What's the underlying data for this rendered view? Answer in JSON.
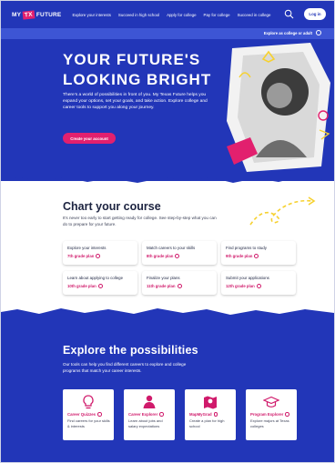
{
  "nav": {
    "logo_pre": "MY",
    "logo_tx": "TX",
    "logo_post": "FUTURE",
    "links": [
      "Explore your interests",
      "Succeed in high school",
      "Apply for college",
      "Pay for college",
      "Succeed in college"
    ],
    "search_icon": "search-icon",
    "login": "Log in"
  },
  "subbar": {
    "label": "Explore as college or adult"
  },
  "hero": {
    "title_line1": "YOUR FUTURE'S",
    "title_line2": "LOOKING BRIGHT",
    "body": "There's a world of possibilities in front of you. My Texas Future helps you expand your options, set your goals, and take action. Explore college and career tools to support you along your journey.",
    "cta": "Create your account"
  },
  "chart": {
    "title": "Chart your course",
    "subtitle": "It's never too early to start getting ready for college. See step-by-step what you can do to prepare for your future.",
    "cards": [
      {
        "title": "Explore your interests",
        "link": "7th grade plan"
      },
      {
        "title": "Match careers to your skills",
        "link": "8th grade plan"
      },
      {
        "title": "Find programs to study",
        "link": "9th grade plan"
      },
      {
        "title": "Learn about applying to college",
        "link": "10th grade plan"
      },
      {
        "title": "Finalize your plans",
        "link": "11th grade plan"
      },
      {
        "title": "Submit your applications",
        "link": "12th grade plan"
      }
    ]
  },
  "explore": {
    "title": "Explore the possibilities",
    "subtitle": "Our tools can help you find different careers to explore and college programs that match your career interests.",
    "tools": [
      {
        "name": "Career Quizzes",
        "desc": "Find careers for your skills & interests",
        "icon": "lightbulb-icon"
      },
      {
        "name": "Career Explorer",
        "desc": "Learn about jobs and salary expectations",
        "icon": "person-icon"
      },
      {
        "name": "MapMyGrad",
        "desc": "Create a plan for high school",
        "icon": "map-pin-icon"
      },
      {
        "name": "Program Explorer",
        "desc": "Explore majors at Texas colleges",
        "icon": "graduation-cap-icon"
      }
    ]
  },
  "colors": {
    "primary": "#2236b8",
    "accent": "#e2206e",
    "yellow": "#f6d130"
  }
}
